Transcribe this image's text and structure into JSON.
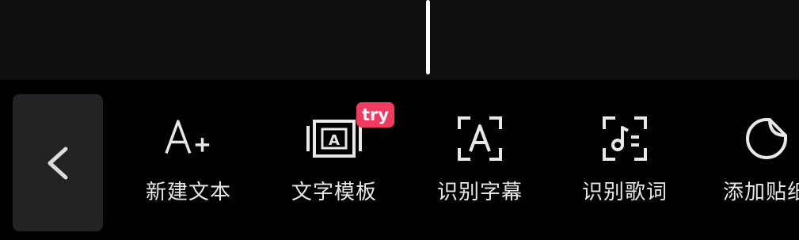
{
  "toolbar": {
    "items": [
      {
        "label": "新建文本",
        "icon": "add-text-icon"
      },
      {
        "label": "文字模板",
        "icon": "text-template-icon",
        "badge": "try"
      },
      {
        "label": "识别字幕",
        "icon": "recognize-subtitle-icon"
      },
      {
        "label": "识别歌词",
        "icon": "recognize-lyrics-icon"
      },
      {
        "label": "添加贴纸",
        "icon": "sticker-icon"
      }
    ]
  },
  "colors": {
    "badge": "#f03a5f",
    "panel": "#232325",
    "timeline": "#0f0f0f"
  }
}
